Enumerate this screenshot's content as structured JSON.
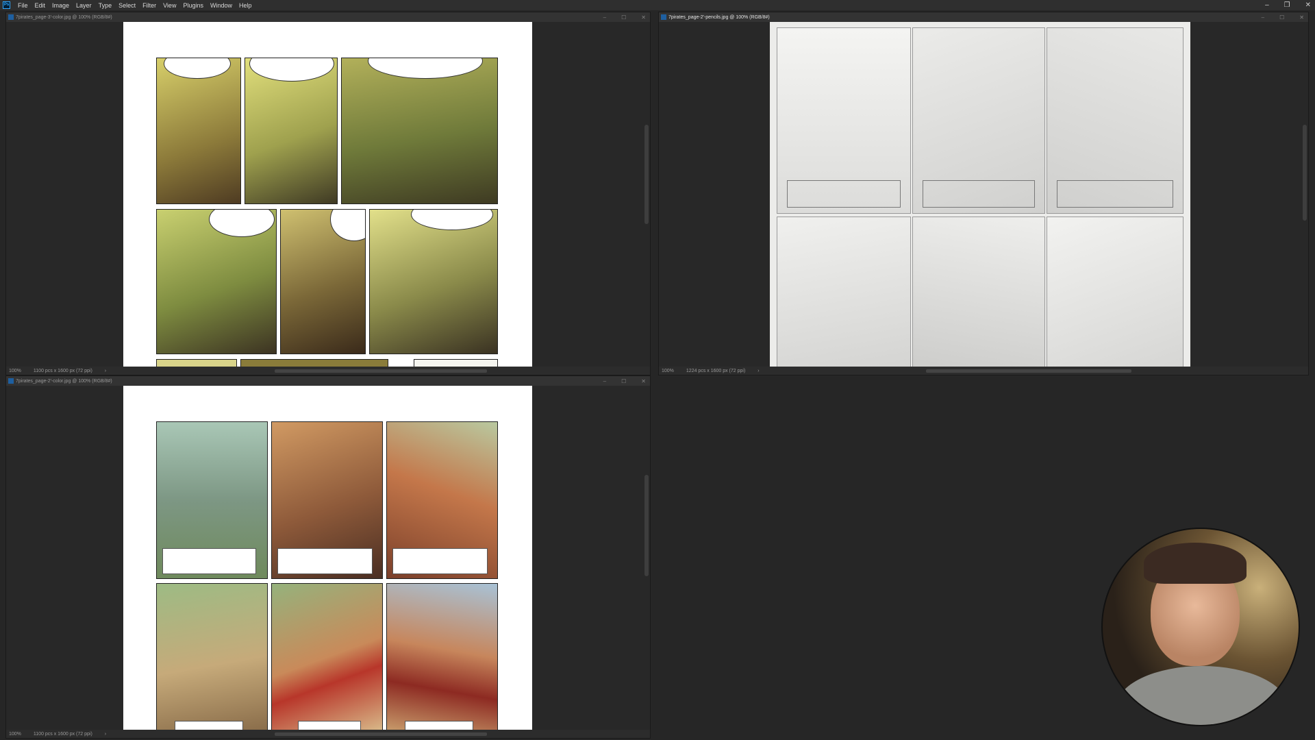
{
  "app": {
    "menu": [
      "File",
      "Edit",
      "Image",
      "Layer",
      "Type",
      "Select",
      "Filter",
      "View",
      "Plugins",
      "Window",
      "Help"
    ],
    "window_controls": [
      "–",
      "❐",
      "✕"
    ]
  },
  "windows": [
    {
      "title": "7pirates_page-3'-color.jpg @ 100% (RGB/8#)",
      "zoom": "100%",
      "dims": "1100 pcs x 1600 px (72 ppi)"
    },
    {
      "title": "7pirates_page-2'-pencils.jpg @ 100% (RGB/8#)",
      "zoom": "100%",
      "dims": "1224 pcs x 1600 px (72 ppi)"
    },
    {
      "title": "7pirates_page-2'-color.jpg @ 100% (RGB/8#)",
      "zoom": "100%",
      "dims": "1100 pcs x 1600 px (72 ppi)"
    }
  ],
  "colors": {
    "panel_colors_page3": [
      "#b7a44a",
      "#8a7c3a",
      "#7c8a3e",
      "#9aa04c",
      "#6f6a38",
      "#a8a55a"
    ],
    "panel_colors_page2": [
      "#8fa997",
      "#b07a52",
      "#a5623c",
      "#7d8e6a",
      "#b9844f",
      "#a36a45"
    ],
    "pencil_bg": "#ececea",
    "app_bg": "#262626",
    "accent": "#31a8ff"
  }
}
